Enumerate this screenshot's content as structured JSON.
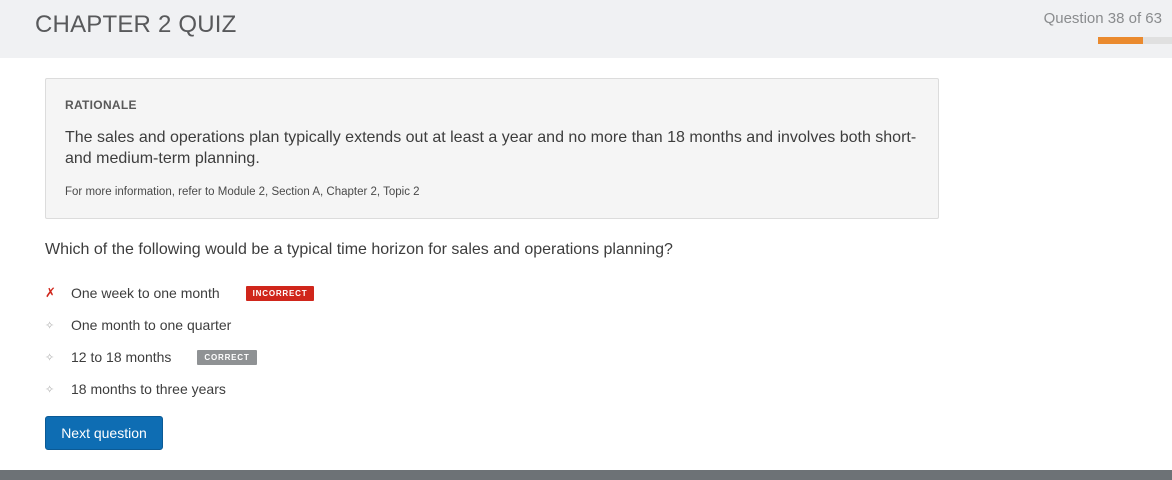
{
  "header": {
    "title": "CHAPTER 2 QUIZ",
    "progress_text": "Question 38 of 63",
    "progress_fraction": 0.603,
    "progress_color": "#ea8a2e"
  },
  "rationale": {
    "heading": "RATIONALE",
    "body": "The sales and operations plan typically extends out at least a year and no more than 18 months and involves both short- and medium-term planning.",
    "reference": "For more information, refer to Module 2, Section A, Chapter 2, Topic 2"
  },
  "question": {
    "text": "Which of the following would be a typical time horizon for sales and operations planning?"
  },
  "answers": [
    {
      "mark_icon": "x-mark-icon",
      "mark": "✗",
      "text": "One week to one month",
      "badge": "INCORRECT"
    },
    {
      "mark_icon": "diamond-bullet-icon",
      "mark": "✧",
      "text": "One month to one quarter",
      "badge": ""
    },
    {
      "mark_icon": "diamond-bullet-icon",
      "mark": "✧",
      "text": "12 to 18 months",
      "badge": "CORRECT"
    },
    {
      "mark_icon": "diamond-bullet-icon",
      "mark": "✧",
      "text": "18 months to three years",
      "badge": ""
    }
  ],
  "actions": {
    "next_label": "Next question"
  },
  "colors": {
    "accent": "#0e6db3",
    "incorrect": "#d0261b",
    "correct_badge": "#8f9294"
  }
}
